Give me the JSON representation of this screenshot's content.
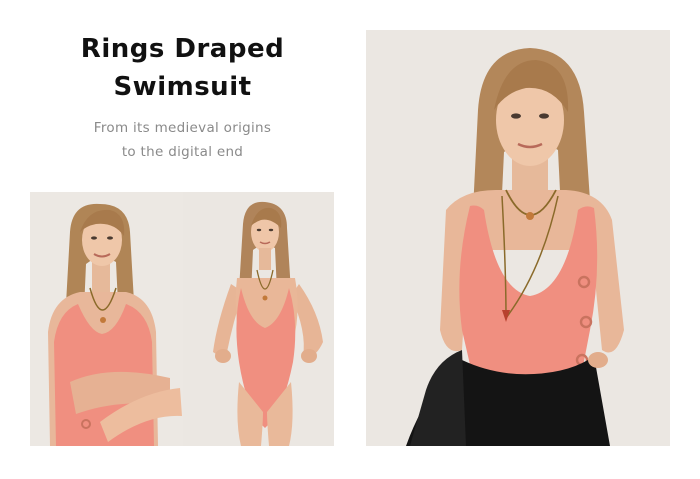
{
  "header": {
    "title_line1": "Rings Draped",
    "title_line2": "Swimsuit",
    "subtitle_line1": "From its medieval origins",
    "subtitle_line2": "to the digital end"
  },
  "colors": {
    "background": "#ffffff",
    "title": "#111111",
    "subtitle": "#8a8a8a",
    "photo_backdrop": "#ebe7e2",
    "swimsuit": "#f08f80",
    "skirt": "#141414"
  },
  "gallery": {
    "images": [
      {
        "name": "model-arms-crossed-photo"
      },
      {
        "name": "model-full-body-photo"
      },
      {
        "name": "model-with-black-skirt-photo"
      }
    ]
  }
}
